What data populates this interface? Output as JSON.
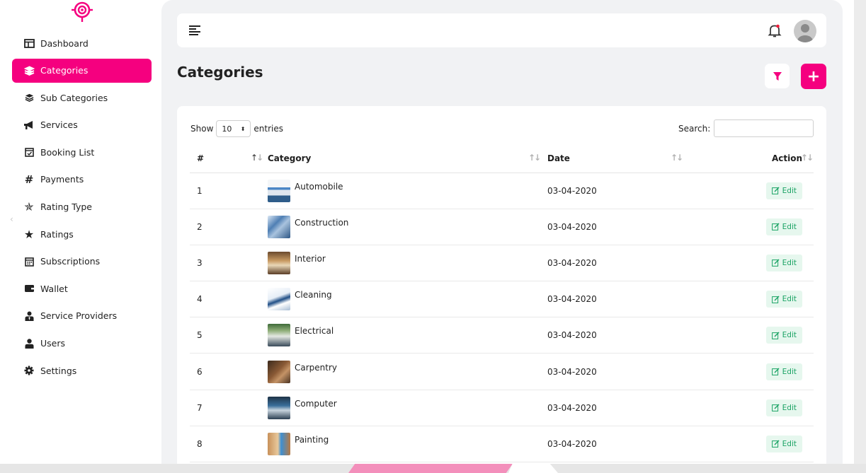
{
  "sidebar": {
    "items": [
      {
        "label": "Dashboard",
        "icon": "dashboard-icon"
      },
      {
        "label": "Categories",
        "icon": "layers-icon",
        "active": true
      },
      {
        "label": "Sub Categories",
        "icon": "layers-small-icon"
      },
      {
        "label": "Services",
        "icon": "megaphone-icon"
      },
      {
        "label": "Booking List",
        "icon": "calendar-check-icon"
      },
      {
        "label": "Payments",
        "icon": "hash-icon"
      },
      {
        "label": "Rating Type",
        "icon": "star-half-icon"
      },
      {
        "label": "Ratings",
        "icon": "star-icon"
      },
      {
        "label": "Subscriptions",
        "icon": "calendar-icon"
      },
      {
        "label": "Wallet",
        "icon": "wallet-icon"
      },
      {
        "label": "Service Providers",
        "icon": "user-tie-icon"
      },
      {
        "label": "Users",
        "icon": "user-icon"
      },
      {
        "label": "Settings",
        "icon": "gear-icon"
      }
    ]
  },
  "page": {
    "title": "Categories"
  },
  "table_controls": {
    "show_label": "Show",
    "entries_value": "10",
    "entries_label": "entries",
    "search_label": "Search:",
    "search_value": ""
  },
  "table": {
    "headers": [
      "#",
      "Category",
      "Date",
      "Action"
    ],
    "edit_label": "Edit",
    "rows": [
      {
        "num": "1",
        "category": "Automobile",
        "date": "03-04-2020"
      },
      {
        "num": "2",
        "category": "Construction",
        "date": "03-04-2020"
      },
      {
        "num": "3",
        "category": "Interior",
        "date": "03-04-2020"
      },
      {
        "num": "4",
        "category": "Cleaning",
        "date": "03-04-2020"
      },
      {
        "num": "5",
        "category": "Electrical",
        "date": "03-04-2020"
      },
      {
        "num": "6",
        "category": "Carpentry",
        "date": "03-04-2020"
      },
      {
        "num": "7",
        "category": "Computer",
        "date": "03-04-2020"
      },
      {
        "num": "8",
        "category": "Painting",
        "date": "03-04-2020"
      }
    ]
  },
  "colors": {
    "accent": "#f5007f",
    "edit_bg": "#e6f7ee",
    "edit_text": "#1aa364",
    "panel_bg": "#f1f2f4"
  }
}
